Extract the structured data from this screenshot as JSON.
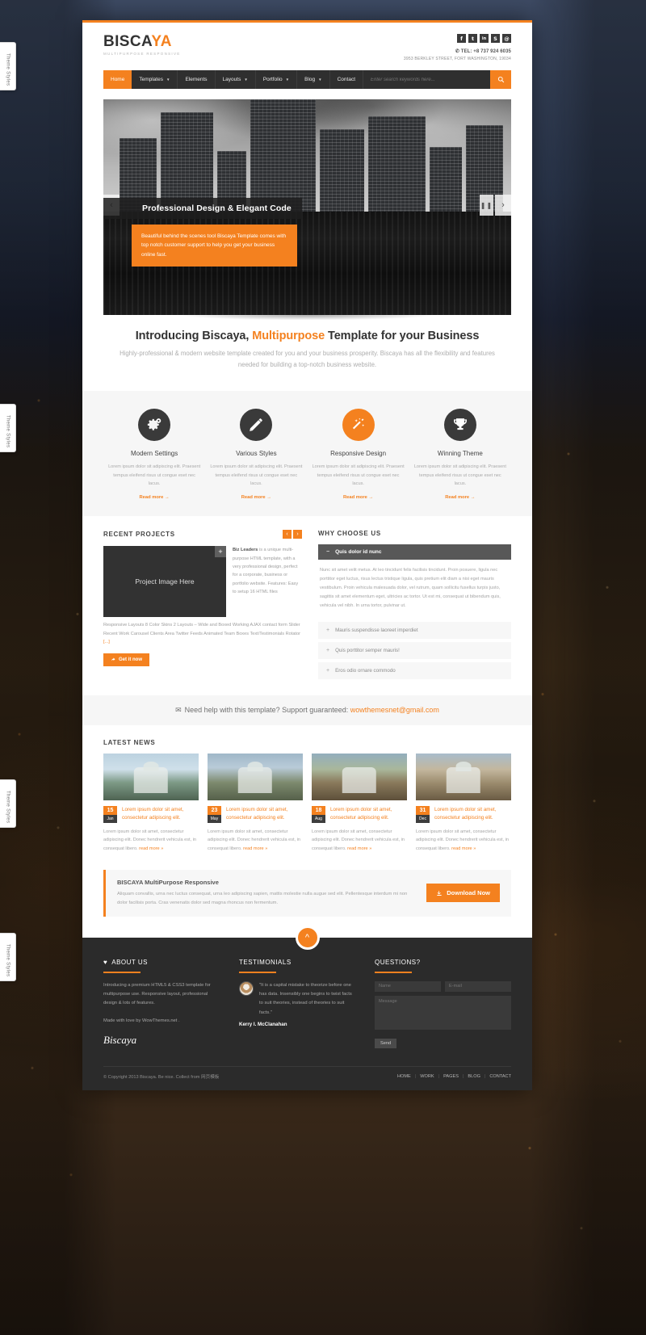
{
  "theme_tabs": [
    {
      "label": "Theme Styles"
    },
    {
      "label": "Theme Styles"
    },
    {
      "label": "Theme Styles"
    },
    {
      "label": "Theme Styles"
    }
  ],
  "header": {
    "logo": "BISCA",
    "logo_accent": "YA",
    "tagline": "MultiPurpose Responsive",
    "socials": [
      {
        "name": "facebook-icon",
        "glyph": "f"
      },
      {
        "name": "twitter-icon",
        "glyph": "🐦"
      },
      {
        "name": "linkedin-icon",
        "glyph": "in"
      },
      {
        "name": "skype-icon",
        "glyph": "S"
      },
      {
        "name": "pinterest-icon",
        "glyph": "@"
      }
    ],
    "phone": "TEL: +8 737 924 6035",
    "address": "3953 BERKLEY STREET, FORT WASHINGTON, 19034"
  },
  "nav": {
    "items": [
      {
        "label": "Home",
        "active": true,
        "caret": false
      },
      {
        "label": "Templates",
        "active": false,
        "caret": true
      },
      {
        "label": "Elements",
        "active": false,
        "caret": false
      },
      {
        "label": "Layouts",
        "active": false,
        "caret": true
      },
      {
        "label": "Portfolio",
        "active": false,
        "caret": true
      },
      {
        "label": "Blog",
        "active": false,
        "caret": true
      },
      {
        "label": "Contact",
        "active": false,
        "caret": false
      }
    ],
    "search_placeholder": "Enter search keywords here..."
  },
  "hero": {
    "caption": "Professional Design & Elegant Code",
    "subtext": "Beautiful behind the scenes tool Biscaya Template comes with top notch customer support to help you get your business online fast."
  },
  "intro": {
    "title_before": "Introducing Biscaya, ",
    "title_highlight": "Multipurpose",
    "title_after": " Template for your Business",
    "paragraph": "Highly-professional & modern website template created for you and your business prosperity. Biscaya has all the flexibility and features needed for building a top-notch business website."
  },
  "features": [
    {
      "icon": "gears-icon",
      "title": "Modern Settings",
      "text": "Lorem ipsum dolor sit adipiscing elit. Praesent tempus eleifend risus ut congue eset nec lacus.",
      "link": "Read more →",
      "accent": false
    },
    {
      "icon": "pencil-icon",
      "title": "Various Styles",
      "text": "Lorem ipsum dolor sit adipiscing elit. Praesent tempus eleifend risus ut congue eset nec lacus.",
      "link": "Read more →",
      "accent": false
    },
    {
      "icon": "magic-wand-icon",
      "title": "Responsive Design",
      "text": "Lorem ipsum dolor sit adipiscing elit. Praesent tempus eleifend risus ut congue eset nec lacus.",
      "link": "Read more →",
      "accent": true
    },
    {
      "icon": "trophy-icon",
      "title": "Winning Theme",
      "text": "Lorem ipsum dolor sit adipiscing elit. Praesent tempus eleifend risus ut congue eset nec lacus.",
      "link": "Read more →",
      "accent": false
    }
  ],
  "projects": {
    "title": "RECENT PROJECTS",
    "prev": "‹",
    "next": "›",
    "image_label": "Project Image Here",
    "lead": "Biz Leaders",
    "text": " is a unique multi-purpose HTML template, with a very professional design, perfect for a corporate, business or portfolio website. Features: Easy to setup 16 HTML files",
    "more": "Responsive Layouts 8 Color Skins 2 Layouts – Wide and Boxed Working AJAX contact form Slider Recent Work Carousel Clients Area Twitter Feeds Animated Team Boxes Text/Testimonials Rotator",
    "more_link": "[...]",
    "button": "Get it now"
  },
  "why": {
    "title": "WHY CHOOSE US",
    "open_item": "Quis dolor id nunc",
    "open_body": "Nunc sit amet velit metus. At leo tincidunt felis facilisis tincidunt. Proin posuere, ligula nec porttitor eget luctus, risus lectus tristique ligula, quis pretium elit diam a nisi eget mauris vestibulum. Proin vehicula malesuada dolor, vel rutrum, quam sollicitu fusellus turpis justo, sagittis sit amet elementum eget, ultricies ac tortor. Ut est mi, consequat ut bibendum quis, vehicula vel nibh. In urna tortor, pulvinar ut.",
    "items": [
      "Mauris suspendisse laoreet imperdiet",
      "Quis porttitor semper mauris!",
      "Eros odio ornare commodo"
    ]
  },
  "support": {
    "text": "Need help with this template? Support guaranteed: ",
    "email": "wowthemesnet@gmail.com"
  },
  "news": {
    "title": "LATEST NEWS",
    "items": [
      {
        "day": "15",
        "month": "Jan",
        "title": "Lorem ipsum dolor sit amet, consectetur adipiscing elit.",
        "body": "Lorem ipsum dolor sit amet, consectetur adipiscing elit. Donec hendrerit vehicula est, in consequat libero. ",
        "read_more": "read more »"
      },
      {
        "day": "23",
        "month": "May",
        "title": "Lorem ipsum dolor sit amet, consectetur adipiscing elit.",
        "body": "Lorem ipsum dolor sit amet, consectetur adipiscing elit. Donec hendrerit vehicula est, in consequat libero. ",
        "read_more": "read more »"
      },
      {
        "day": "18",
        "month": "Aug",
        "title": "Lorem ipsum dolor sit amet, consectetur adipiscing elit.",
        "body": "Lorem ipsum dolor sit amet, consectetur adipiscing elit. Donec hendrerit vehicula est, in consequat libero. ",
        "read_more": "read more »"
      },
      {
        "day": "31",
        "month": "Dec",
        "title": "Lorem ipsum dolor sit amet, consectetur adipiscing elit.",
        "body": "Lorem ipsum dolor sit amet, consectetur adipiscing elit. Donec hendrerit vehicula est, in consequat libero. ",
        "read_more": "read more »"
      }
    ]
  },
  "download": {
    "title": "BISCAYA MultiPurpose Responsive",
    "text": "Aliquam convallis, urna nec luctus consequat, urna leo adipiscing sapien, mattis molestie nulla augue sed elit. Pellentesque interdum mi non dolor facilisis porta. Cras venenatis dolor sed magna rhoncus non fermentum.",
    "button": "Download Now"
  },
  "footer": {
    "about": {
      "title": "ABOUT US",
      "paragraph": "Introducing a premium HTML5 & CSS3 template for multipurpose use. Responsive layout, professional design & lots of features.",
      "made_with": "Made with love by WowThemes.net .",
      "signature": "Biscaya"
    },
    "testimonials": {
      "title": "TESTIMONIALS",
      "quote": "\"It is a capital mistake to theorize before one has data. Insensibly one begins to twist facts to suit theories, instead of theories to suit facts.\"",
      "author": "Kerry I. McClanahan"
    },
    "questions": {
      "title": "QUESTIONS?",
      "name_placeholder": "Name",
      "email_placeholder": "E-mail",
      "message_placeholder": "Message",
      "send_label": "Send"
    },
    "copyright": "© Copyright 2013 Biscaya. Be nice. Collect from 网页模板",
    "links": [
      "HOME",
      "WORK",
      "PAGES",
      "BLOG",
      "CONTACT"
    ]
  }
}
